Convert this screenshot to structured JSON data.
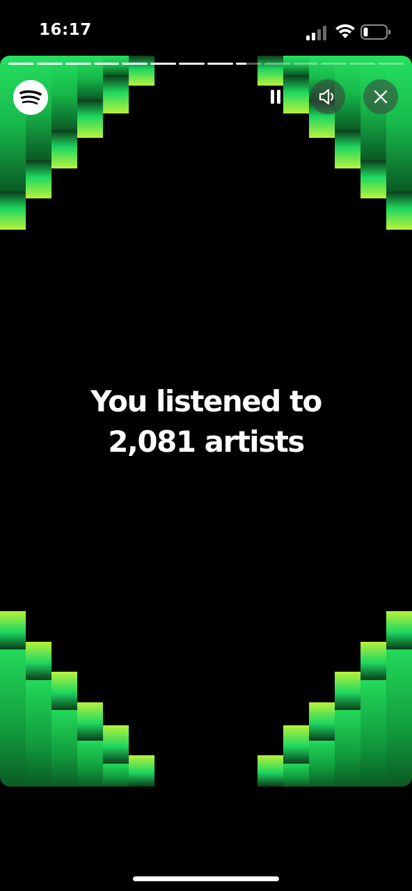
{
  "status_bar": {
    "time": "16:17",
    "signal_icon": "cellular-signal-icon",
    "wifi_icon": "wifi-icon",
    "battery_icon": "battery-low-icon"
  },
  "story": {
    "progress": {
      "segment_count": 14,
      "completed_segments": 8,
      "current_segment_fraction": 0.4
    },
    "logo_icon": "spotify-logo-icon",
    "controls": {
      "pause_icon": "pause-icon",
      "sound_icon": "speaker-icon",
      "close_icon": "close-icon"
    },
    "headline": {
      "line1": "You listened to",
      "line2": "2,081 artists"
    },
    "colors": {
      "accent_green": "#1ED760",
      "lime": "#B7F23C",
      "dark_green": "#0B3D1A"
    }
  }
}
